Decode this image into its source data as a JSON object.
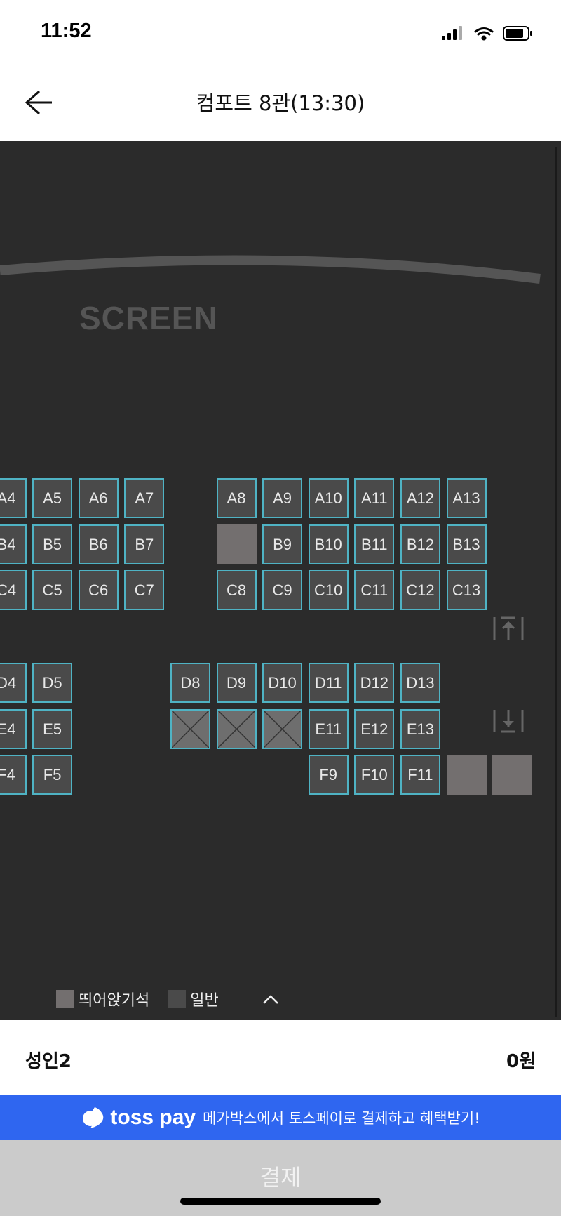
{
  "status_bar": {
    "time": "11:52"
  },
  "header": {
    "title": "컴포트 8관(13:30)",
    "back_icon": "arrow-left-icon"
  },
  "stage": {
    "screen_label": "SCREEN"
  },
  "seat_rows": [
    {
      "row": "A",
      "seats": [
        {
          "label": "A4",
          "status": "available"
        },
        {
          "label": "A5",
          "status": "available"
        },
        {
          "label": "A6",
          "status": "available"
        },
        {
          "label": "A7",
          "status": "available"
        },
        {
          "label": "A8",
          "status": "available"
        },
        {
          "label": "A9",
          "status": "available"
        },
        {
          "label": "A10",
          "status": "available"
        },
        {
          "label": "A11",
          "status": "available"
        },
        {
          "label": "A12",
          "status": "available"
        },
        {
          "label": "A13",
          "status": "available"
        }
      ]
    },
    {
      "row": "B",
      "seats": [
        {
          "label": "B4",
          "status": "available"
        },
        {
          "label": "B5",
          "status": "available"
        },
        {
          "label": "B6",
          "status": "available"
        },
        {
          "label": "B7",
          "status": "available"
        },
        {
          "label": "",
          "status": "distance"
        },
        {
          "label": "B9",
          "status": "available"
        },
        {
          "label": "B10",
          "status": "available"
        },
        {
          "label": "B11",
          "status": "available"
        },
        {
          "label": "B12",
          "status": "available"
        },
        {
          "label": "B13",
          "status": "available"
        }
      ]
    },
    {
      "row": "C",
      "seats": [
        {
          "label": "C4",
          "status": "available"
        },
        {
          "label": "C5",
          "status": "available"
        },
        {
          "label": "C6",
          "status": "available"
        },
        {
          "label": "C7",
          "status": "available"
        },
        {
          "label": "C8",
          "status": "available"
        },
        {
          "label": "C9",
          "status": "available"
        },
        {
          "label": "C10",
          "status": "available"
        },
        {
          "label": "C11",
          "status": "available"
        },
        {
          "label": "C12",
          "status": "available"
        },
        {
          "label": "C13",
          "status": "available"
        }
      ]
    },
    {
      "row": "D",
      "seats": [
        {
          "label": "D4",
          "status": "available"
        },
        {
          "label": "D5",
          "status": "available"
        },
        {
          "label": "D8",
          "status": "available"
        },
        {
          "label": "D9",
          "status": "available"
        },
        {
          "label": "D10",
          "status": "available"
        },
        {
          "label": "D11",
          "status": "available"
        },
        {
          "label": "D12",
          "status": "available"
        },
        {
          "label": "D13",
          "status": "available"
        }
      ]
    },
    {
      "row": "E",
      "seats": [
        {
          "label": "E4",
          "status": "available"
        },
        {
          "label": "E5",
          "status": "available"
        },
        {
          "label": "",
          "status": "blocked"
        },
        {
          "label": "",
          "status": "blocked"
        },
        {
          "label": "",
          "status": "blocked"
        },
        {
          "label": "E11",
          "status": "available"
        },
        {
          "label": "E12",
          "status": "available"
        },
        {
          "label": "E13",
          "status": "available"
        }
      ]
    },
    {
      "row": "F",
      "seats": [
        {
          "label": "F4",
          "status": "available"
        },
        {
          "label": "F5",
          "status": "available"
        },
        {
          "label": "F9",
          "status": "available"
        },
        {
          "label": "F10",
          "status": "available"
        },
        {
          "label": "F11",
          "status": "available"
        },
        {
          "label": "",
          "status": "distance"
        },
        {
          "label": "",
          "status": "distance"
        }
      ]
    }
  ],
  "legend": {
    "items": [
      {
        "label": "띄어앉기석",
        "color": "#736f6f"
      },
      {
        "label": "일반",
        "color": "#4a4a4a"
      }
    ],
    "toggle_icon": "chevron-up-icon"
  },
  "summary": {
    "ticket": "성인2",
    "price": "0원"
  },
  "toss_banner": {
    "brand": "toss pay",
    "text": "메가박스에서 토스페이로 결제하고 혜택받기!"
  },
  "pay_button": {
    "label": "결제"
  },
  "colors": {
    "seat_border": "#4fb3c4",
    "background": "#2b2b2b",
    "toss": "#2f66f0"
  }
}
